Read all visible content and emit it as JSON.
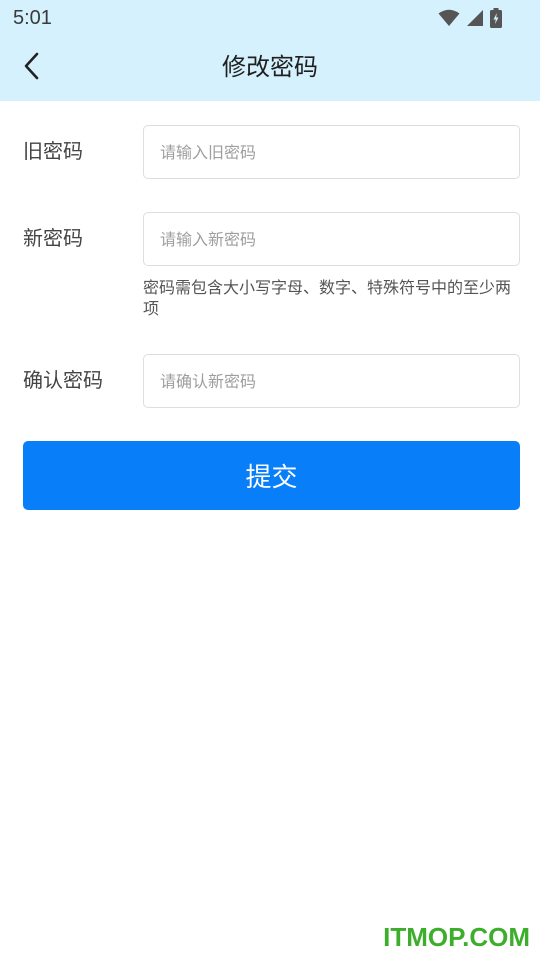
{
  "status_bar": {
    "time": "5:01",
    "icons": [
      "wifi-icon",
      "signal-icon",
      "battery-charging-icon"
    ]
  },
  "header": {
    "title": "修改密码",
    "back_icon": "chevron-left-icon"
  },
  "form": {
    "old_password": {
      "label": "旧密码",
      "placeholder": "请输入旧密码",
      "value": ""
    },
    "new_password": {
      "label": "新密码",
      "placeholder": "请输入新密码",
      "value": "",
      "hint": "密码需包含大小写字母、数字、特殊符号中的至少两项"
    },
    "confirm_password": {
      "label": "确认密码",
      "placeholder": "请确认新密码",
      "value": ""
    },
    "submit_label": "提交"
  },
  "watermark": "ITMOP.COM",
  "colors": {
    "header_bg": "#d5f1fd",
    "primary": "#087ff9",
    "watermark": "#3cae2b"
  }
}
